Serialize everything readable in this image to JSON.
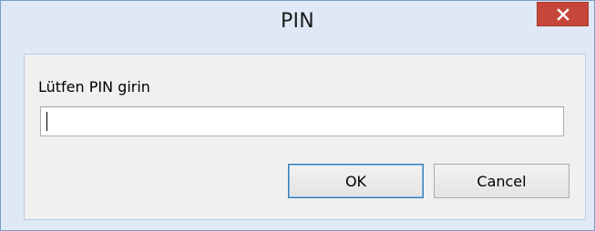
{
  "window": {
    "title": "PIN",
    "close_icon": "close-icon"
  },
  "dialog": {
    "prompt_label": "Lütfen PIN girin",
    "pin_value": "",
    "pin_placeholder": ""
  },
  "buttons": {
    "ok_label": "OK",
    "cancel_label": "Cancel"
  },
  "colors": {
    "close_button": "#c7463b",
    "window_frame": "#dfe9f5",
    "client_background": "#f0f0f0"
  }
}
